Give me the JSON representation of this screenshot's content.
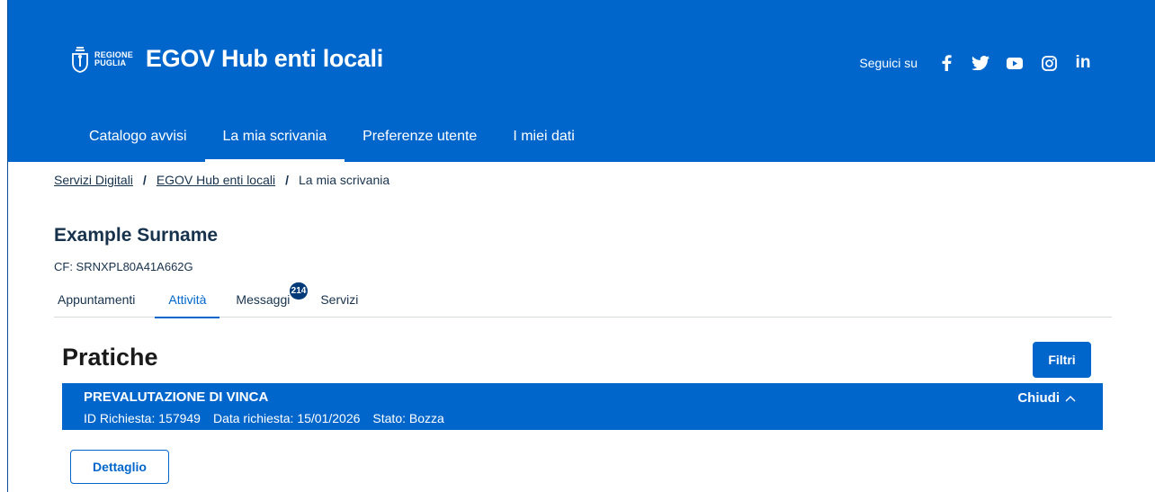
{
  "header": {
    "region_line1": "REGIONE",
    "region_line2": "PUGLIA",
    "app_title": "EGOV Hub enti locali",
    "social_label": "Seguici su",
    "social_icons": [
      "facebook-icon",
      "twitter-icon",
      "youtube-icon",
      "instagram-icon",
      "linkedin-icon"
    ],
    "linkedin_text": "in",
    "background_color": "#0066cc"
  },
  "nav": {
    "items": [
      {
        "label": "Catalogo avvisi"
      },
      {
        "label": "La mia scrivania"
      },
      {
        "label": "Preferenze utente"
      },
      {
        "label": "I miei dati"
      }
    ]
  },
  "breadcrumb": {
    "items": [
      {
        "label": "Servizi Digitali"
      },
      {
        "label": "EGOV Hub enti locali"
      },
      {
        "label": "La mia scrivania"
      }
    ],
    "separator": "/"
  },
  "profile": {
    "name": "Example Surname",
    "fiscal_code": "CF: SRNXPL80A41A662G"
  },
  "tabs": {
    "items": [
      {
        "label": "Appuntamenti"
      },
      {
        "label": "Attività"
      },
      {
        "label": "Messaggi",
        "badge": "214"
      },
      {
        "label": "Servizi"
      }
    ]
  },
  "section": {
    "title": "Pratiche",
    "filter_label": "Filtri"
  },
  "practice": {
    "title": "PREVALUTAZIONE DI VINCA",
    "id": "ID Richiesta: 157949",
    "date": "Data richiesta: 15/01/2026",
    "status": "Stato: Bozza",
    "toggle_label": "Chiudi",
    "detail_label": "Dettaglio"
  },
  "colors": {
    "primary": "#0066cc",
    "text": "#17324d",
    "badge": "#003a78"
  }
}
